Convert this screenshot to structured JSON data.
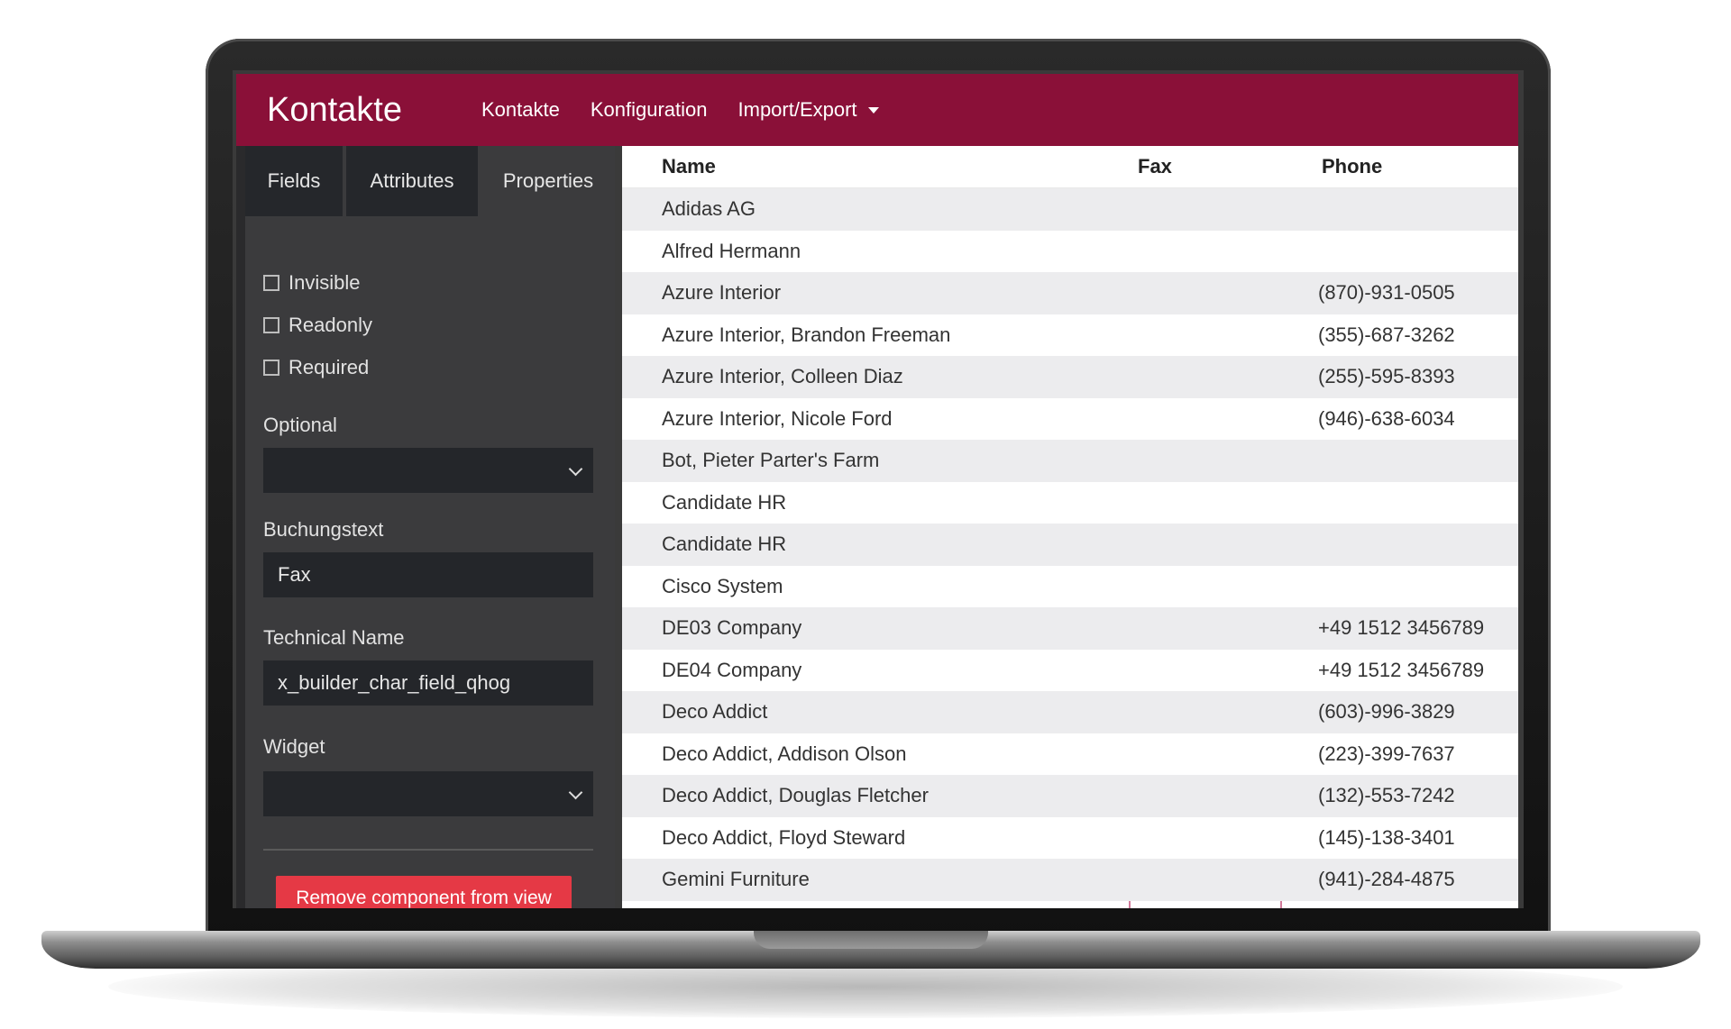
{
  "app": {
    "brand": "Kontakte",
    "nav": [
      "Kontakte",
      "Konfiguration",
      "Import/Export"
    ]
  },
  "sidebar": {
    "tabs": [
      "Fields",
      "Attributes",
      "Properties"
    ],
    "active_tab": "Properties",
    "checkboxes": [
      "Invisible",
      "Readonly",
      "Required"
    ],
    "optional_label": "Optional",
    "optional_value": "",
    "buchungstext_label": "Buchungstext",
    "buchungstext_value": "Fax",
    "technical_name_label": "Technical Name",
    "technical_name_value": "x_builder_char_field_qhog",
    "widget_label": "Widget",
    "widget_value": "",
    "remove_button": "Remove component from view"
  },
  "table": {
    "columns": [
      "Name",
      "Fax",
      "Phone"
    ],
    "rows": [
      {
        "name": "Adidas AG",
        "fax": "",
        "phone": ""
      },
      {
        "name": "Alfred Hermann",
        "fax": "",
        "phone": ""
      },
      {
        "name": "Azure Interior",
        "fax": "",
        "phone": "(870)-931-0505"
      },
      {
        "name": "Azure Interior, Brandon Freeman",
        "fax": "",
        "phone": "(355)-687-3262"
      },
      {
        "name": "Azure Interior, Colleen Diaz",
        "fax": "",
        "phone": "(255)-595-8393"
      },
      {
        "name": "Azure Interior, Nicole Ford",
        "fax": "",
        "phone": "(946)-638-6034"
      },
      {
        "name": "Bot, Pieter Parter's Farm",
        "fax": "",
        "phone": ""
      },
      {
        "name": "Candidate HR",
        "fax": "",
        "phone": ""
      },
      {
        "name": "Candidate HR",
        "fax": "",
        "phone": ""
      },
      {
        "name": "Cisco System",
        "fax": "",
        "phone": ""
      },
      {
        "name": "DE03 Company",
        "fax": "",
        "phone": "+49 1512 3456789"
      },
      {
        "name": "DE04 Company",
        "fax": "",
        "phone": "+49 1512 3456789"
      },
      {
        "name": "Deco Addict",
        "fax": "",
        "phone": "(603)-996-3829"
      },
      {
        "name": "Deco Addict, Addison Olson",
        "fax": "",
        "phone": "(223)-399-7637"
      },
      {
        "name": "Deco Addict, Douglas Fletcher",
        "fax": "",
        "phone": "(132)-553-7242"
      },
      {
        "name": "Deco Addict, Floyd Steward",
        "fax": "",
        "phone": "(145)-138-3401"
      },
      {
        "name": "Gemini Furniture",
        "fax": "",
        "phone": "(941)-284-4875"
      }
    ]
  },
  "colors": {
    "brand": "#8a1038",
    "danger": "#e53945",
    "sidebar": "#3b3b3d",
    "column_divider": "#d27a9a"
  }
}
